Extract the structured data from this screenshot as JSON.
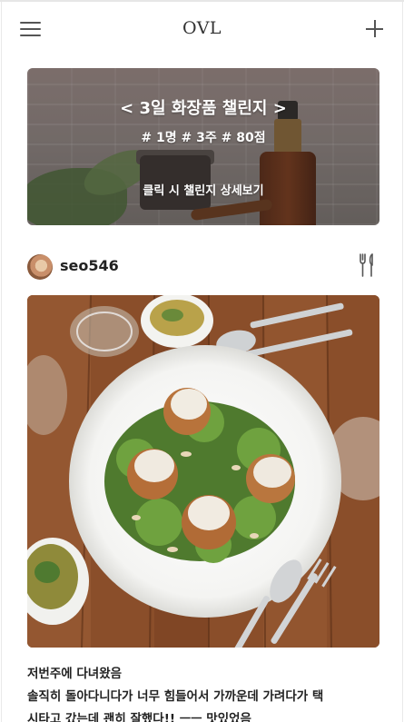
{
  "header": {
    "title": "OVL",
    "menu_icon": "hamburger-menu-icon",
    "add_icon": "plus-icon"
  },
  "banner": {
    "title": "< 3일 화장품 챌린지 >",
    "tags": "# 1명 # 3주 # 80점",
    "cta": "클릭 시 챌린지 상세보기"
  },
  "post": {
    "username": "seo546",
    "category_icon": "fork-knife-icon",
    "image_description_icon": "food-photo",
    "caption_line1": "저번주에 다녀왔음",
    "caption_line2": "솔직히 돌아다니다가 너무 힘들어서 가까운데 가려다가 택",
    "caption_line3": "시타고 갔는데 괜히 잘했다!! ㅡㅡ 맛있었음"
  },
  "colors": {
    "text": "#222222",
    "banner_text": "#ffffff",
    "icon": "#555555"
  }
}
